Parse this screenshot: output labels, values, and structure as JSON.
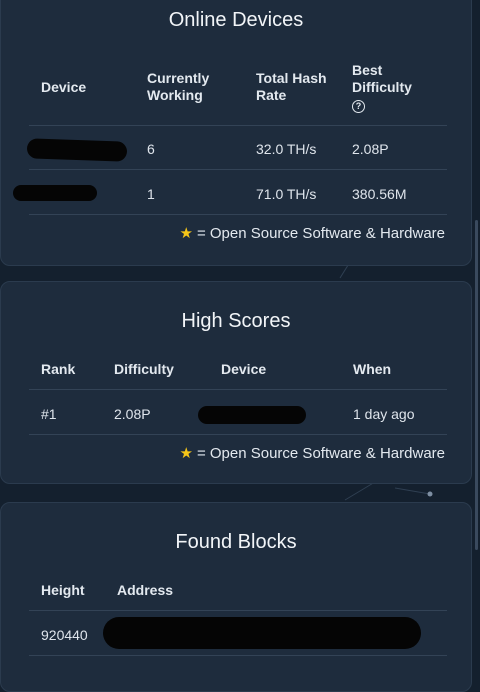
{
  "online_devices": {
    "title": "Online Devices",
    "columns": [
      "Device",
      "Currently Working",
      "Total Hash Rate",
      "Best Difficulty"
    ],
    "help_icon": "?",
    "rows": [
      {
        "device": "",
        "working": "6",
        "hash_rate": "32.0 TH/s",
        "best": "2.08P"
      },
      {
        "device": "",
        "working": "1",
        "hash_rate": "71.0 TH/s",
        "best": "380.56M"
      }
    ],
    "footnote": "= Open Source Software & Hardware"
  },
  "high_scores": {
    "title": "High Scores",
    "columns": [
      "Rank",
      "Difficulty",
      "Device",
      "When"
    ],
    "rows": [
      {
        "rank": "#1",
        "difficulty": "2.08P",
        "device": "",
        "when": "1 day ago"
      }
    ],
    "footnote": "= Open Source Software & Hardware"
  },
  "found_blocks": {
    "title": "Found Blocks",
    "columns": [
      "Height",
      "Address"
    ],
    "rows": [
      {
        "height": "920440",
        "address": ""
      }
    ]
  },
  "icons": {
    "star": "star-icon",
    "help": "help-circle-icon"
  },
  "colors": {
    "background": "#14202e",
    "card": "#1e2c3d",
    "star": "#f5c518"
  }
}
